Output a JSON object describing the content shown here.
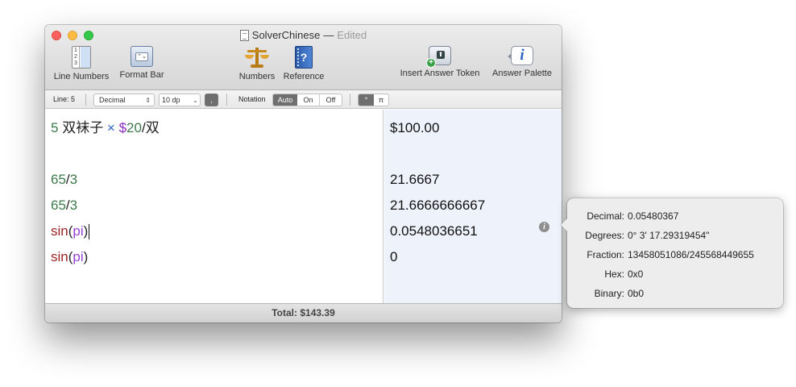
{
  "window": {
    "title": "SolverChinese",
    "separator": "—",
    "edited": "Edited"
  },
  "toolbar": {
    "line_numbers": "Line Numbers",
    "line_numbers_icon_text": "1\n2\n3",
    "format_bar": "Format Bar",
    "format_bar_icon_text": "⌃⌄",
    "numbers": "Numbers",
    "reference": "Reference",
    "reference_icon_text": "?",
    "insert_answer_token": "Insert Answer Token",
    "answer_palette": "Answer Palette",
    "answer_palette_icon_text": "i"
  },
  "format_bar": {
    "line_label": "Line: 5",
    "format_value": "Decimal",
    "places_value": "10 dp",
    "separator_button": ",",
    "notation_label": "Notation",
    "notation_options": [
      "Auto",
      "On",
      "Off"
    ],
    "notation_selected": "Auto",
    "angle_options": [
      "°",
      "π"
    ],
    "angle_selected": "°"
  },
  "editor": {
    "lines": [
      {
        "tokens": [
          {
            "t": "5",
            "c": "num"
          },
          {
            "t": " 双袜子 ",
            "c": "text"
          },
          {
            "t": "×",
            "c": "op"
          },
          {
            "t": " $",
            "c": "cur"
          },
          {
            "t": "20",
            "c": "num"
          },
          {
            "t": "/双",
            "c": "text"
          }
        ]
      },
      {
        "tokens": []
      },
      {
        "tokens": [
          {
            "t": "65",
            "c": "num"
          },
          {
            "t": "/",
            "c": "text"
          },
          {
            "t": "3",
            "c": "num"
          }
        ]
      },
      {
        "tokens": [
          {
            "t": "65",
            "c": "num"
          },
          {
            "t": "/",
            "c": "text"
          },
          {
            "t": "3",
            "c": "num"
          }
        ]
      },
      {
        "tokens": [
          {
            "t": "sin",
            "c": "fn"
          },
          {
            "t": "(",
            "c": "text"
          },
          {
            "t": "pi",
            "c": "const"
          },
          {
            "t": ")",
            "c": "text"
          }
        ],
        "caret": true
      },
      {
        "tokens": [
          {
            "t": "sin",
            "c": "fn"
          },
          {
            "t": "(",
            "c": "text"
          },
          {
            "t": "pi",
            "c": "const"
          },
          {
            "t": ")",
            "c": "text"
          }
        ]
      }
    ]
  },
  "results": [
    "$100.00",
    "",
    "21.6667",
    "21.6666666667",
    "0.0548036651",
    "0"
  ],
  "status": {
    "total_label": "Total:",
    "total_value": "$143.39"
  },
  "popover": {
    "rows": [
      {
        "label": "Decimal:",
        "value": "0.05480367"
      },
      {
        "label": "Degrees:",
        "value": "0° 3' 17.29319454\""
      },
      {
        "label": "Fraction:",
        "value": "13458051086/245568449655"
      },
      {
        "label": "Hex:",
        "value": "0x0"
      },
      {
        "label": "Binary:",
        "value": "0b0"
      }
    ]
  },
  "colors": {
    "number": "#3d7a4b",
    "operator": "#2a63c6",
    "currency": "#8b2bc0",
    "function": "#9b2323",
    "constant": "#9340d4",
    "results_background": "#eef2fb"
  },
  "icons": {
    "line_numbers": "line-numbers-icon",
    "format_bar": "format-bar-icon",
    "numbers": "scale-icon",
    "reference": "book-icon",
    "insert_answer_token": "answer-token-icon",
    "answer_palette": "info-bubble-icon",
    "result_info": "info-icon"
  }
}
